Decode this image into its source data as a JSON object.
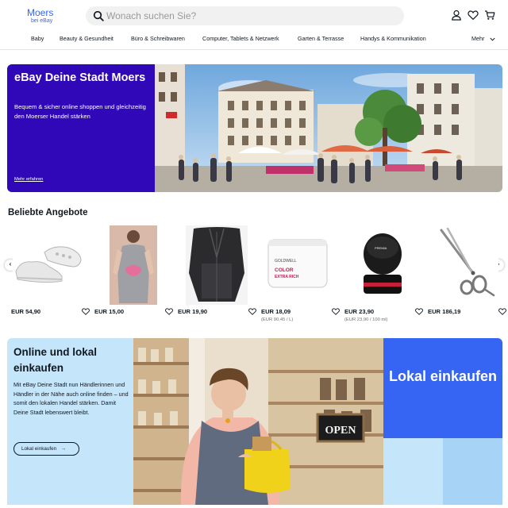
{
  "header": {
    "logo_main": "Moers",
    "logo_sub": "bei eBay",
    "search_placeholder": "Wonach suchen Sie?"
  },
  "categories": [
    "Baby",
    "Beauty & Gesundheit",
    "Büro & Schreibwaren",
    "Computer, Tablets & Netzwerk",
    "Garten & Terrasse",
    "Handys & Kommunikation"
  ],
  "more_label": "Mehr",
  "hero": {
    "title": "eBay Deine Stadt Moers",
    "text": "Bequem & sicher online shoppen und gleichzeitig den Moerser Handel stärken",
    "link": "Mehr erfahren",
    "bg_color": "#3008b8"
  },
  "deals": {
    "title": "Beliebte Angebote",
    "items": [
      {
        "price": "EUR 54,90",
        "unit": "",
        "image": "white-sneakers"
      },
      {
        "price": "EUR 15,00",
        "unit": "",
        "image": "grey-nightgown"
      },
      {
        "price": "EUR 19,90",
        "unit": "",
        "image": "black-velvet-suit"
      },
      {
        "price": "EUR 18,09",
        "unit": "(EUR 90,45 / L)",
        "image": "goldwell-color-extra-rich-mask"
      },
      {
        "price": "EUR 23,90",
        "unit": "(EUR 23,90 / 100 ml)",
        "image": "premia-hair-pomade"
      },
      {
        "price": "EUR 186,19",
        "unit": "",
        "image": "hair-scissors"
      }
    ]
  },
  "promo": {
    "title": "Online und lokal einkaufen",
    "text": "Mit eBay Deine Stadt nun Händlerinnen und Händler in der Nähe auch online finden – und somit den lokalen Handel stärken. Damit Deine Stadt lebenswert bleibt.",
    "button": "Lokal einkaufen",
    "right_title": "Lokal einkaufen",
    "sign_text": "OPEN",
    "left_bg": "#c5e5fb",
    "right_bg": "#3665f3"
  }
}
